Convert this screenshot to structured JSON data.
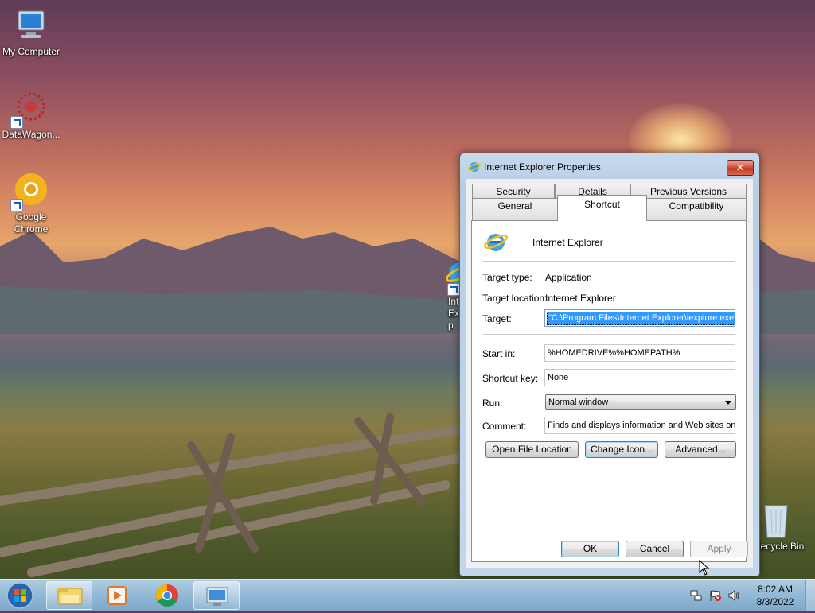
{
  "desktop": {
    "icons": [
      {
        "label": "My Computer"
      },
      {
        "label": "DataWagon..."
      },
      {
        "label": "Google Chrome"
      },
      {
        "label": "Int Exp"
      },
      {
        "label": "Recycle Bin"
      }
    ]
  },
  "dialog": {
    "title": "Internet Explorer Properties",
    "close_label": "✕",
    "tabs_row1": [
      {
        "label": "Security"
      },
      {
        "label": "Details"
      },
      {
        "label": "Previous Versions"
      }
    ],
    "tabs_row2": [
      {
        "label": "General"
      },
      {
        "label": "Shortcut"
      },
      {
        "label": "Compatibility"
      }
    ],
    "app_name": "Internet Explorer",
    "fields": {
      "target_type_label": "Target type:",
      "target_type_value": "Application",
      "target_location_label": "Target location:",
      "target_location_value": "Internet Explorer",
      "target_label": "Target:",
      "target_value": "\"C:\\Program Files\\Internet Explorer\\iexplore.exe\"",
      "start_in_label": "Start in:",
      "start_in_value": "%HOMEDRIVE%%HOMEPATH%",
      "shortcut_key_label": "Shortcut key:",
      "shortcut_key_value": "None",
      "run_label": "Run:",
      "run_value": "Normal window",
      "comment_label": "Comment:",
      "comment_value": "Finds and displays information and Web sites on th"
    },
    "buttons": {
      "open_file_location": "Open File Location",
      "change_icon": "Change Icon...",
      "advanced": "Advanced...",
      "ok": "OK",
      "cancel": "Cancel",
      "apply": "Apply"
    }
  },
  "taskbar": {
    "clock_time": "8:02 AM",
    "clock_date": "8/3/2022"
  },
  "colors": {
    "selection": "#3399ff",
    "taskbar": "#96bede",
    "dialog_frame": "#b7cde6"
  }
}
